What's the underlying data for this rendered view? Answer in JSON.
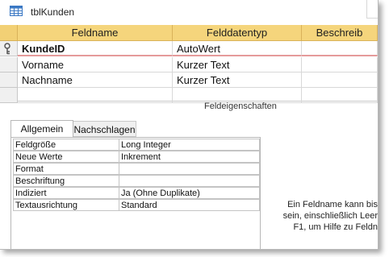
{
  "window": {
    "title": "tblKunden"
  },
  "grid": {
    "columns": [
      "Feldname",
      "Felddatentyp",
      "Beschreib"
    ],
    "rows": [
      {
        "name": "KundeID",
        "type": "AutoWert",
        "desc": ""
      },
      {
        "name": "Vorname",
        "type": "Kurzer Text",
        "desc": ""
      },
      {
        "name": "Nachname",
        "type": "Kurzer Text",
        "desc": ""
      },
      {
        "name": "",
        "type": "",
        "desc": ""
      }
    ]
  },
  "properties": {
    "section_label": "Feldeigenschaften",
    "tabs": [
      "Allgemein",
      "Nachschlagen"
    ],
    "active_tab": "Allgemein",
    "rows": [
      {
        "label": "Feldgröße",
        "value": "Long Integer"
      },
      {
        "label": "Neue Werte",
        "value": "Inkrement"
      },
      {
        "label": "Format",
        "value": ""
      },
      {
        "label": "Beschriftung",
        "value": ""
      },
      {
        "label": "Indiziert",
        "value": "Ja (Ohne Duplikate)"
      },
      {
        "label": "Textausrichtung",
        "value": "Standard"
      }
    ]
  },
  "help": {
    "lines": [
      "Ein Feldname kann bis",
      "sein, einschließlich Leer",
      "F1, um Hilfe zu Feldn"
    ]
  },
  "colors": {
    "header": "#f5d57c",
    "active_row_line": "#e59a9a"
  },
  "icons": {
    "title": "table-icon",
    "row_selector": "primary-key-icon"
  }
}
